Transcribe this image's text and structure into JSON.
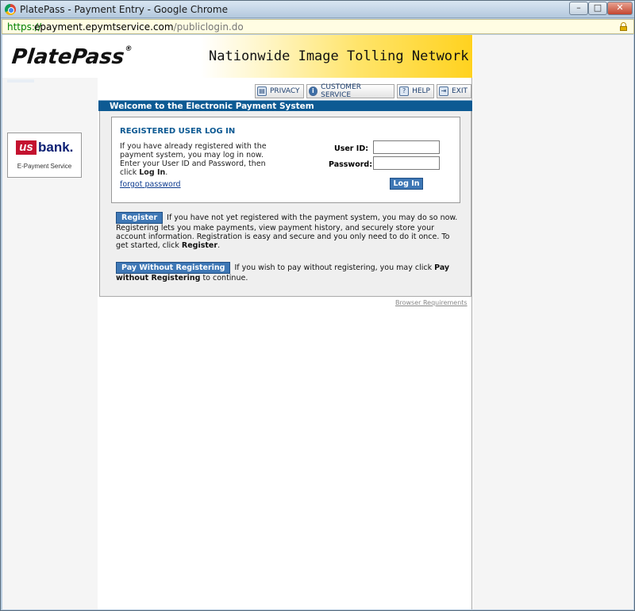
{
  "window": {
    "title": "PlatePass - Payment Entry - Google Chrome",
    "controls": {
      "minimize": "–",
      "maximize": "□",
      "close": "✕"
    }
  },
  "address": {
    "scheme": "https://",
    "host": "epayment.epymtservice.com",
    "path": "/publiclogin.do"
  },
  "header": {
    "logo_text": "PlatePass",
    "logo_mark": "®",
    "tagline": "Nationwide Image Tolling Network"
  },
  "nav": {
    "items": [
      {
        "label": "PRIVACY",
        "icon": "privacy-icon",
        "glyph": "▤"
      },
      {
        "label": "CUSTOMER SERVICE",
        "icon": "info-icon",
        "glyph": "i"
      },
      {
        "label": "HELP",
        "icon": "help-icon",
        "glyph": "?"
      },
      {
        "label": "EXIT",
        "icon": "exit-icon",
        "glyph": "⇥"
      }
    ]
  },
  "welcome": "Welcome to the Electronic Payment System",
  "login": {
    "title": "REGISTERED USER LOG IN",
    "desc_text": "If you have already registered with the payment system, you may log in now. Enter your User ID and Password, then click ",
    "desc_bold": "Log In",
    "desc_end": ".",
    "forgot": "forgot password",
    "userid_label": "User ID:",
    "password_label": "Password:",
    "userid_value": "",
    "password_value": "",
    "button": "Log In"
  },
  "register": {
    "button": "Register",
    "text": "If you have not yet registered with the payment system, you may do so now. Registering lets you make payments, view payment history, and securely store your account information. Registration is easy and secure and you only need to do it once. To get started, click ",
    "bold": "Register",
    "end": "."
  },
  "pay": {
    "button": "Pay Without Registering",
    "text": "If you wish to pay without registering, you may click ",
    "bold": "Pay without Registering",
    "end": " to continue."
  },
  "browser_requirements": "Browser Requirements",
  "sidebar": {
    "bank_us": "us",
    "bank_name": "bank.",
    "bank_sub": "E-Payment Service"
  },
  "colors": {
    "header_bar": "#0d5a93",
    "button_blue": "#3e77b5",
    "header_yellow": "#ffd21f"
  }
}
